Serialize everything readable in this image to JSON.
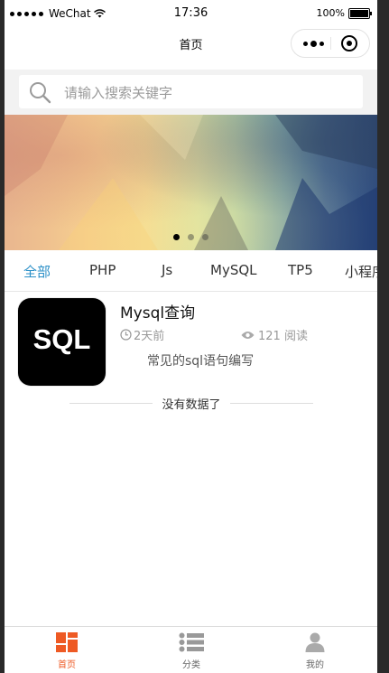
{
  "status_bar": {
    "carrier": "WeChat",
    "time": "17:36",
    "battery": "100%"
  },
  "navbar": {
    "title": "首页"
  },
  "search": {
    "placeholder": "请输入搜索关键字"
  },
  "banner": {
    "slide_count": 3,
    "active_index": 0
  },
  "categories": [
    "全部",
    "PHP",
    "Js",
    "MySQL",
    "TP5",
    "小程序"
  ],
  "active_category": "全部",
  "article": {
    "thumb_text": "SQL",
    "title": "Mysql查询",
    "time": "2天前",
    "views": "121 阅读",
    "desc": "常见的sql语句编写"
  },
  "list_end_text": "没有数据了",
  "tabbar": {
    "items": [
      {
        "label": "首页",
        "icon": "home-grid-icon"
      },
      {
        "label": "分类",
        "icon": "list-icon"
      },
      {
        "label": "我的",
        "icon": "user-icon"
      }
    ],
    "active_color": "#ee5a24",
    "accent_color": "#2a8fc7"
  }
}
